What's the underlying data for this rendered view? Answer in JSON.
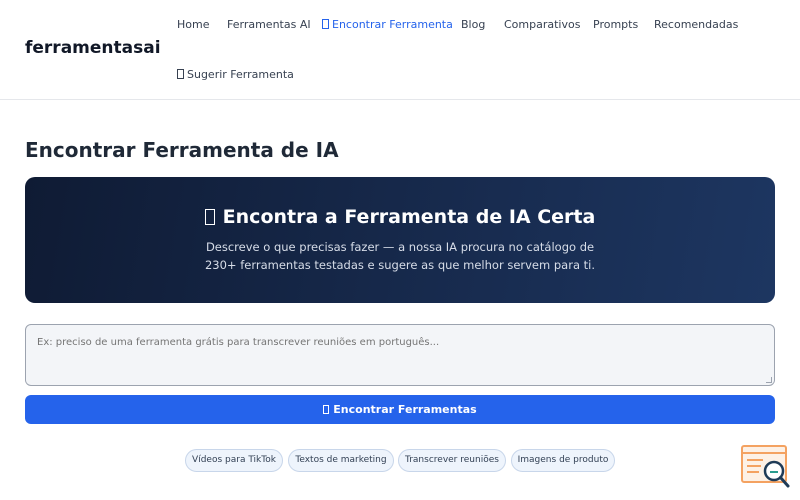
{
  "header": {
    "logo": "ferramentasai",
    "nav": [
      {
        "label": "Home"
      },
      {
        "label": "Ferramentas AI"
      },
      {
        "label": "Encontrar Ferramenta",
        "active": true,
        "icon": "magnifier-emoji-glyph"
      },
      {
        "label": "Blog"
      },
      {
        "label": "Comparativos"
      },
      {
        "label": "Prompts"
      },
      {
        "label": "Recomendadas"
      },
      {
        "label": "Sugerir Ferramenta",
        "icon": "lightbulb-emoji-glyph"
      }
    ]
  },
  "main": {
    "title": "Encontrar Ferramenta de IA",
    "hero": {
      "title": "Encontra a Ferramenta de IA Certa",
      "subtitle_line1": "Descreve o que precisas fazer — a nossa IA procura no catálogo de",
      "subtitle_line2": "230+ ferramentas testadas e sugere as que melhor servem para ti."
    },
    "search": {
      "placeholder": "Ex: preciso de uma ferramenta grátis para transcrever reuniões em português..."
    },
    "button_label": "Encontrar Ferramentas",
    "suggestions": [
      "Vídeos para TikTok",
      "Textos de marketing",
      "Transcrever reuniões",
      "Imagens de produto"
    ]
  },
  "colors": {
    "accent": "#2563eb",
    "hero_bg": "#0f1b34",
    "chip_bg": "#eef4fc",
    "widget_orange": "#f4a261"
  },
  "icons": {
    "widget": "search-document-icon"
  }
}
